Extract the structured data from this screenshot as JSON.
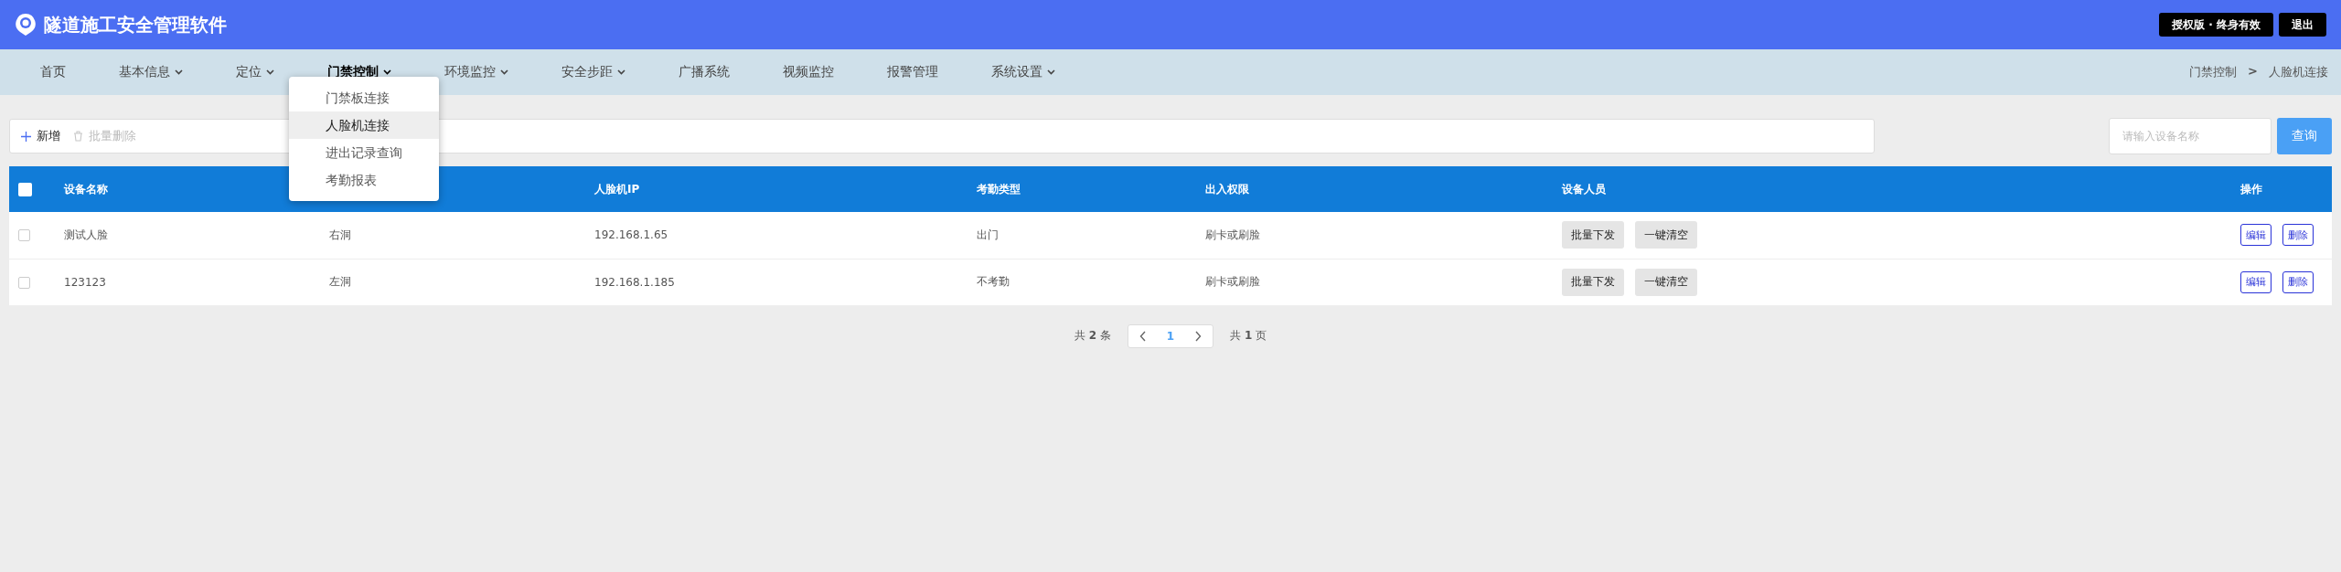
{
  "header": {
    "title": "隧道施工安全管理软件",
    "license": "授权版 · 终身有效",
    "logout": "退出"
  },
  "nav": {
    "items": [
      {
        "label": "首页",
        "has_dropdown": false,
        "selected": false
      },
      {
        "label": "基本信息",
        "has_dropdown": true,
        "selected": false
      },
      {
        "label": "定位",
        "has_dropdown": true,
        "selected": false
      },
      {
        "label": "门禁控制",
        "has_dropdown": true,
        "selected": true,
        "menu": [
          {
            "label": "门禁板连接",
            "selected": false
          },
          {
            "label": "人脸机连接",
            "selected": true
          },
          {
            "label": "进出记录查询",
            "selected": false
          },
          {
            "label": "考勤报表",
            "selected": false
          }
        ]
      },
      {
        "label": "环境监控",
        "has_dropdown": true,
        "selected": false
      },
      {
        "label": "安全步距",
        "has_dropdown": true,
        "selected": false
      },
      {
        "label": "广播系统",
        "has_dropdown": false,
        "selected": false
      },
      {
        "label": "视频监控",
        "has_dropdown": false,
        "selected": false
      },
      {
        "label": "报警管理",
        "has_dropdown": false,
        "selected": false
      },
      {
        "label": "系统设置",
        "has_dropdown": true,
        "selected": false
      }
    ],
    "breadcrumb": [
      "门禁控制",
      "人脸机连接"
    ],
    "breadcrumb_separator": ">"
  },
  "toolbar": {
    "add": "新增",
    "batch_delete": "批量删除",
    "search": {
      "placeholder": "请输入设备名称"
    },
    "query": "查询"
  },
  "table": {
    "header_checked": false,
    "columns": [
      "设备名称",
      "",
      "人脸机IP",
      "考勤类型",
      "出入权限",
      "设备人员",
      "操作"
    ],
    "rows": [
      {
        "checked": false,
        "name": "测试人脸",
        "column_2": "右洞",
        "ip": "192.168.1.65",
        "attendance": "出门",
        "access": "刷卡或刷脸",
        "staff_buttons": [
          "批量下发",
          "一键清空"
        ],
        "actions": [
          "编辑",
          "删除"
        ]
      },
      {
        "checked": false,
        "name": "123123",
        "column_2": "左洞",
        "ip": "192.168.1.185",
        "attendance": "不考勤",
        "access": "刷卡或刷脸",
        "staff_buttons": [
          "批量下发",
          "一键清空"
        ],
        "actions": [
          "编辑",
          "删除"
        ]
      }
    ]
  },
  "pagination": {
    "total": "共 **2** 条",
    "pages": [
      {
        "label": "1",
        "selected": true
      }
    ],
    "page_count": "共 **1** 页"
  }
}
